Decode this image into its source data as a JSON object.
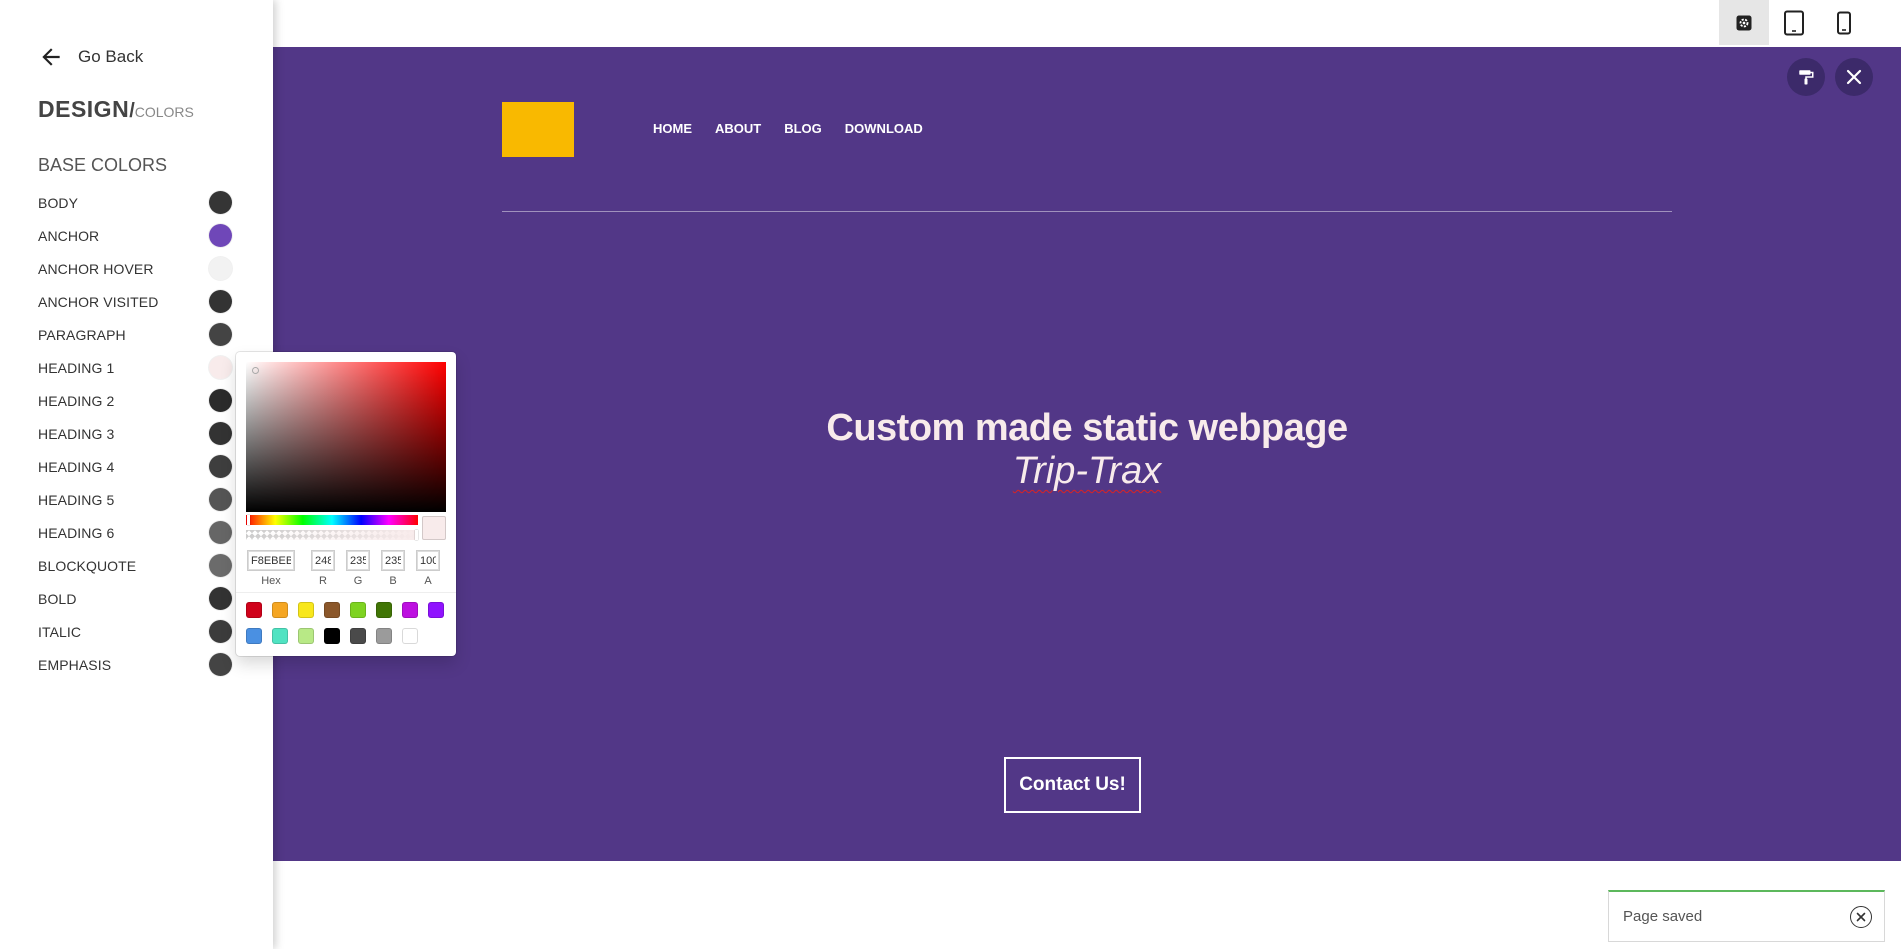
{
  "sidebar": {
    "go_back": "Go Back",
    "title_main": "DESIGN",
    "title_slash": "/",
    "title_sub": "COLORS",
    "section_title": "BASE COLORS",
    "colors": [
      {
        "label": "BODY",
        "color": "#353535"
      },
      {
        "label": "ANCHOR",
        "color": "#6f47b8"
      },
      {
        "label": "ANCHOR HOVER",
        "color": "#f2f2f2"
      },
      {
        "label": "ANCHOR VISITED",
        "color": "#333333"
      },
      {
        "label": "PARAGRAPH",
        "color": "#444444"
      },
      {
        "label": "HEADING 1",
        "color": "#f8ebeb"
      },
      {
        "label": "HEADING 2",
        "color": "#2b2b2b"
      },
      {
        "label": "HEADING 3",
        "color": "#333333"
      },
      {
        "label": "HEADING 4",
        "color": "#3e3e3e"
      },
      {
        "label": "HEADING 5",
        "color": "#555555"
      },
      {
        "label": "HEADING 6",
        "color": "#666666"
      },
      {
        "label": "BLOCKQUOTE",
        "color": "#6b6b6b"
      },
      {
        "label": "BOLD",
        "color": "#333333"
      },
      {
        "label": "ITALIC",
        "color": "#3c3c3c"
      },
      {
        "label": "EMPHASIS",
        "color": "#444444"
      }
    ]
  },
  "picker": {
    "hex": "F8EBEB",
    "r": "248",
    "g": "235",
    "b": "235",
    "a": "100",
    "labels": {
      "hex": "Hex",
      "r": "R",
      "g": "G",
      "b": "B",
      "a": "A"
    },
    "current_color": "#f8ebeb",
    "presets": [
      "#d0021b",
      "#f5a623",
      "#f8e71c",
      "#8b572a",
      "#7ed321",
      "#417505",
      "#bd10e0",
      "#9013fe",
      "#4a90e2",
      "#50e3c2",
      "#b8e986",
      "#000000",
      "#4a4a4a",
      "#9b9b9b",
      "#ffffff"
    ]
  },
  "topbar": {
    "devices": [
      {
        "icon": "settings-icon",
        "active": true
      },
      {
        "icon": "tablet-icon",
        "active": false
      },
      {
        "icon": "mobile-icon",
        "active": false
      }
    ]
  },
  "preview": {
    "background": "#523787",
    "logo_color": "#f9b900",
    "nav": [
      "HOME",
      "ABOUT",
      "BLOG",
      "DOWNLOAD"
    ],
    "headline": "Custom made static webpage",
    "subheadline": "Trip-Trax",
    "cta": "Contact Us!"
  },
  "toast": {
    "message": "Page saved"
  }
}
